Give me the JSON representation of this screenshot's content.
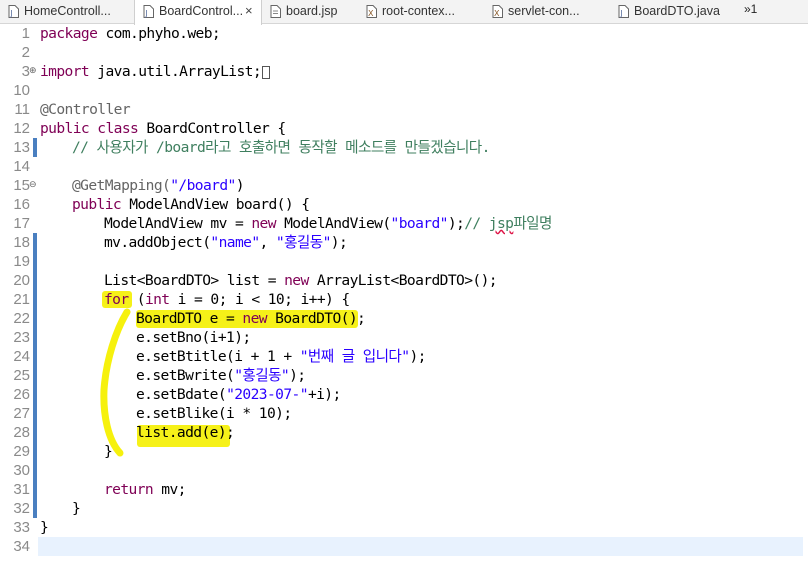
{
  "tabs": [
    {
      "label": "HomeControll...",
      "icon": "java-file-icon",
      "active": false
    },
    {
      "label": "BoardControl...",
      "icon": "java-file-icon",
      "active": true,
      "close": "×"
    },
    {
      "label": "board.jsp",
      "icon": "jsp-file-icon",
      "active": false
    },
    {
      "label": "root-contex...",
      "icon": "xml-file-icon",
      "active": false
    },
    {
      "label": "servlet-con...",
      "icon": "xml-file-icon",
      "active": false
    },
    {
      "label": "BoardDTO.java",
      "icon": "java-file-icon",
      "active": false
    }
  ],
  "overflow_label": "»1",
  "line_numbers": [
    "1",
    "2",
    "3",
    "10",
    "11",
    "12",
    "13",
    "14",
    "15",
    "16",
    "17",
    "18",
    "19",
    "20",
    "21",
    "22",
    "23",
    "24",
    "25",
    "26",
    "27",
    "28",
    "29",
    "30",
    "31",
    "32",
    "33",
    "34"
  ],
  "code": {
    "l1a": "package",
    "l1b": " com.phyho.web;",
    "l3a": "import",
    "l3b": " java.util.ArrayList;",
    "l11": "@Controller",
    "l12a": "public class",
    "l12b": " BoardController {",
    "l13": "// 사용자가 /board라고 호출하면 동작할 메소드를 만들겠습니다.",
    "l15a": "@GetMapping(",
    "l15b": "\"/board\"",
    "l15c": ")",
    "l16a": "public",
    "l16b": " ModelAndView board() {",
    "l17a": "ModelAndView mv = ",
    "l17b": "new",
    "l17c": " ModelAndView(",
    "l17d": "\"board\"",
    "l17e": ");",
    "l17f": "// ",
    "l17g": "jsp",
    "l17h": "파일명",
    "l18a": "mv.addObject(",
    "l18b": "\"name\"",
    "l18c": ", ",
    "l18d": "\"홍길동\"",
    "l18e": ");",
    "l20a": "List<BoardDTO> list = ",
    "l20b": "new",
    "l20c": " ArrayList<BoardDTO>();",
    "l21a": "for",
    "l21b": " (",
    "l21c": "int",
    "l21d": " i = 0; i < 10; i++) {",
    "l22a": "BoardDTO e = ",
    "l22b": "new",
    "l22c": " BoardDTO();",
    "l23": "e.setBno(i+1);",
    "l24a": "e.setBtitle(i + 1 + ",
    "l24b": "\"번째 글 입니다\"",
    "l24c": ");",
    "l25a": "e.setBwrite(",
    "l25b": "\"홍길동\"",
    "l25c": ");",
    "l26a": "e.setBdate(",
    "l26b": "\"2023-07-\"",
    "l26c": "+i);",
    "l27": "e.setBlike(i * 10);",
    "l28": "list.add(e);",
    "l29": "}",
    "l31a": "return",
    "l31b": " mv;",
    "l32": "}",
    "l33": "}"
  },
  "colors": {
    "keyword": "#7f0055",
    "string": "#2a00ff",
    "comment": "#3f7f5f",
    "annotation": "#646464",
    "highlighter": "#f5f000",
    "change_marker": "#4a7fc0",
    "current_line": "#e8f2fe"
  }
}
